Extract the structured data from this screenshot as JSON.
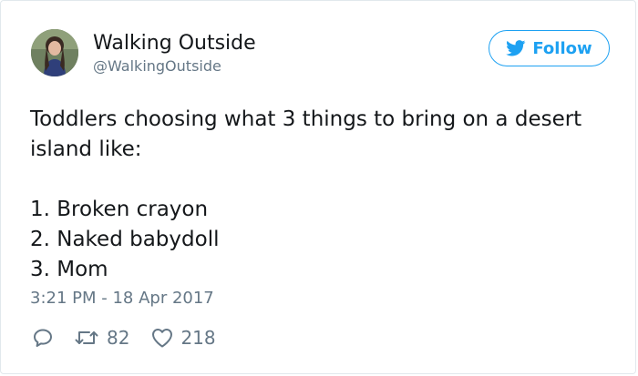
{
  "author": {
    "display_name": "Walking Outside",
    "handle": "@WalkingOutside",
    "avatar_icon": "profile-photo"
  },
  "follow_button": {
    "label": "Follow",
    "icon": "twitter-bird-icon",
    "color": "#1da1f2"
  },
  "tweet": {
    "text": "Toddlers choosing what 3 things to bring on a desert\nisland like:\n\n1. Broken crayon\n2. Naked babydoll\n3. Mom",
    "timestamp": "3:21 PM - 18 Apr 2017"
  },
  "actions": {
    "reply_icon": "reply-icon",
    "retweet_icon": "retweet-icon",
    "retweet_count": "82",
    "like_icon": "heart-icon",
    "like_count": "218"
  },
  "colors": {
    "text": "#14171a",
    "secondary_text": "#657786",
    "border": "#e1e8ed",
    "accent": "#1da1f2"
  }
}
